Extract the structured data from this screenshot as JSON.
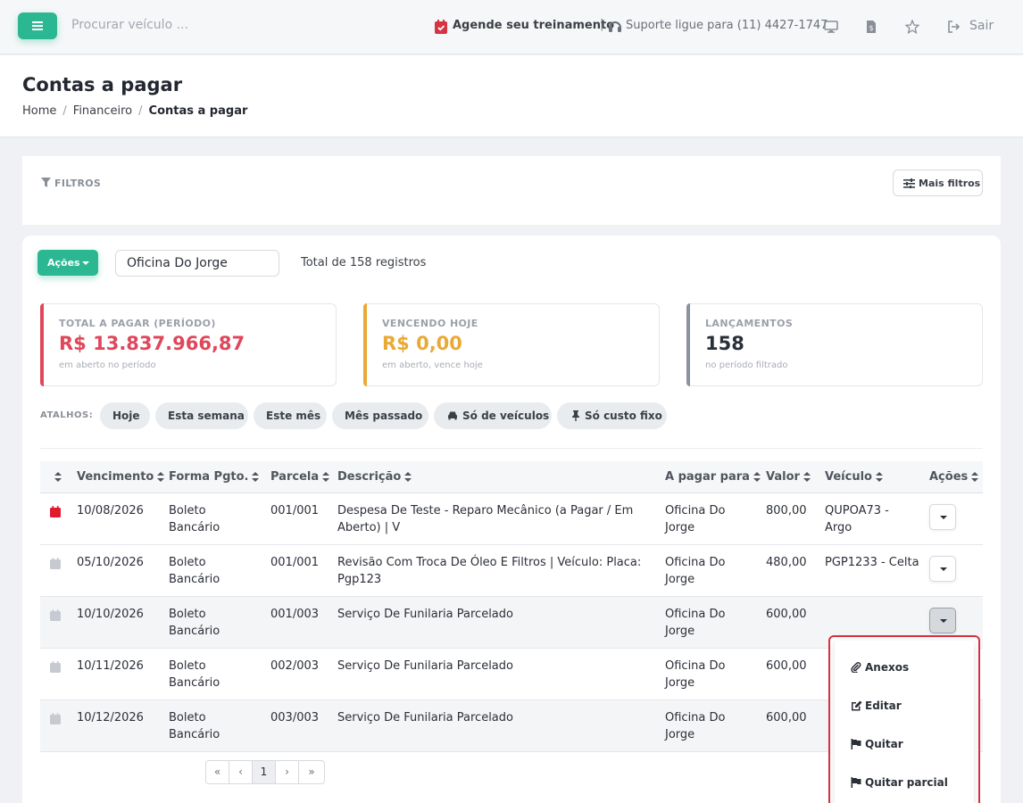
{
  "topbar": {
    "search_placeholder": "Procurar veículo ...",
    "training_label": "Agende seu treinamento",
    "separator": "|",
    "support_label": "Suporte ligue para (11) 4427-1747",
    "logout_label": "Sair",
    "icons": [
      "menu-icon",
      "calendar-check-icon",
      "headset-icon",
      "monitor-icon",
      "document-money-icon",
      "star-icon",
      "logout-icon"
    ]
  },
  "page": {
    "title": "Contas a pagar",
    "breadcrumb": [
      "Home",
      "Financeiro",
      "Contas a pagar"
    ]
  },
  "filters": {
    "label": "FILTROS",
    "more_filters": "Mais filtros"
  },
  "toolbar": {
    "actions_label": "Ações",
    "supplier_value": "Oficina Do Jorge",
    "total_records": "Total de 158 registros"
  },
  "stats": [
    {
      "label": "TOTAL A PAGAR (PERÍODO)",
      "value": "R$ 13.837.966,87",
      "sub": "em aberto no período",
      "color": "#e0475b"
    },
    {
      "label": "VENCENDO HOJE",
      "value": "R$ 0,00",
      "sub": "em aberto, vence hoje",
      "color": "#e9aa35"
    },
    {
      "label": "LANÇAMENTOS",
      "value": "158",
      "sub": "no período filtrado",
      "color": "#8a929e"
    }
  ],
  "shortcuts": {
    "label": "ATALHOS:",
    "items": [
      "Hoje",
      "Esta semana",
      "Este mês",
      "Mês passado",
      "Só de veículos",
      "Só custo fixo"
    ]
  },
  "table": {
    "columns": [
      "Vencimento",
      "Forma Pgto.",
      "Parcela",
      "Descrição",
      "A pagar para",
      "Valor",
      "Veículo",
      "Ações"
    ],
    "rows": [
      {
        "due": "10/08/2026",
        "method_1": "Boleto",
        "method_2": "Bancário",
        "installment": "001/001",
        "desc_1": "Despesa De Teste - Reparo Mecânico (a Pagar / Em",
        "desc_2": "Aberto) | V",
        "payee_1": "Oficina Do",
        "payee_2": "Jorge",
        "value": "800,00",
        "vehicle_1": "QUPOA73 -",
        "vehicle_2": "Argo",
        "overdue": true
      },
      {
        "due": "05/10/2026",
        "method_1": "Boleto",
        "method_2": "Bancário",
        "installment": "001/001",
        "desc_1": "Revisão Com Troca De Óleo E Filtros | Veículo: Placa:",
        "desc_2": "Pgp123",
        "payee_1": "Oficina Do",
        "payee_2": "Jorge",
        "value": "480,00",
        "vehicle_1": "PGP1233 - Celta",
        "vehicle_2": "",
        "overdue": false
      },
      {
        "due": "10/10/2026",
        "method_1": "Boleto",
        "method_2": "Bancário",
        "installment": "001/003",
        "desc_1": "Serviço De Funilaria Parcelado",
        "desc_2": "",
        "payee_1": "Oficina Do",
        "payee_2": "Jorge",
        "value": "600,00",
        "vehicle_1": "",
        "vehicle_2": "",
        "overdue": false
      },
      {
        "due": "10/11/2026",
        "method_1": "Boleto",
        "method_2": "Bancário",
        "installment": "002/003",
        "desc_1": "Serviço De Funilaria Parcelado",
        "desc_2": "",
        "payee_1": "Oficina Do",
        "payee_2": "Jorge",
        "value": "600,00",
        "vehicle_1": "",
        "vehicle_2": "",
        "overdue": false
      },
      {
        "due": "10/12/2026",
        "method_1": "Boleto",
        "method_2": "Bancário",
        "installment": "003/003",
        "desc_1": "Serviço De Funilaria Parcelado",
        "desc_2": "",
        "payee_1": "Oficina Do",
        "payee_2": "Jorge",
        "value": "600,00",
        "vehicle_1": "",
        "vehicle_2": "",
        "overdue": false
      }
    ]
  },
  "pagination": [
    "«",
    "‹",
    "1",
    "›",
    "»"
  ],
  "dropdown": {
    "items": [
      "Anexos",
      "Editar",
      "Quitar",
      "Quitar parcial"
    ]
  },
  "colors": {
    "accent": "#2bb792",
    "danger": "#e0475b",
    "warning": "#e9aa35",
    "highlight_border": "#d63343"
  }
}
